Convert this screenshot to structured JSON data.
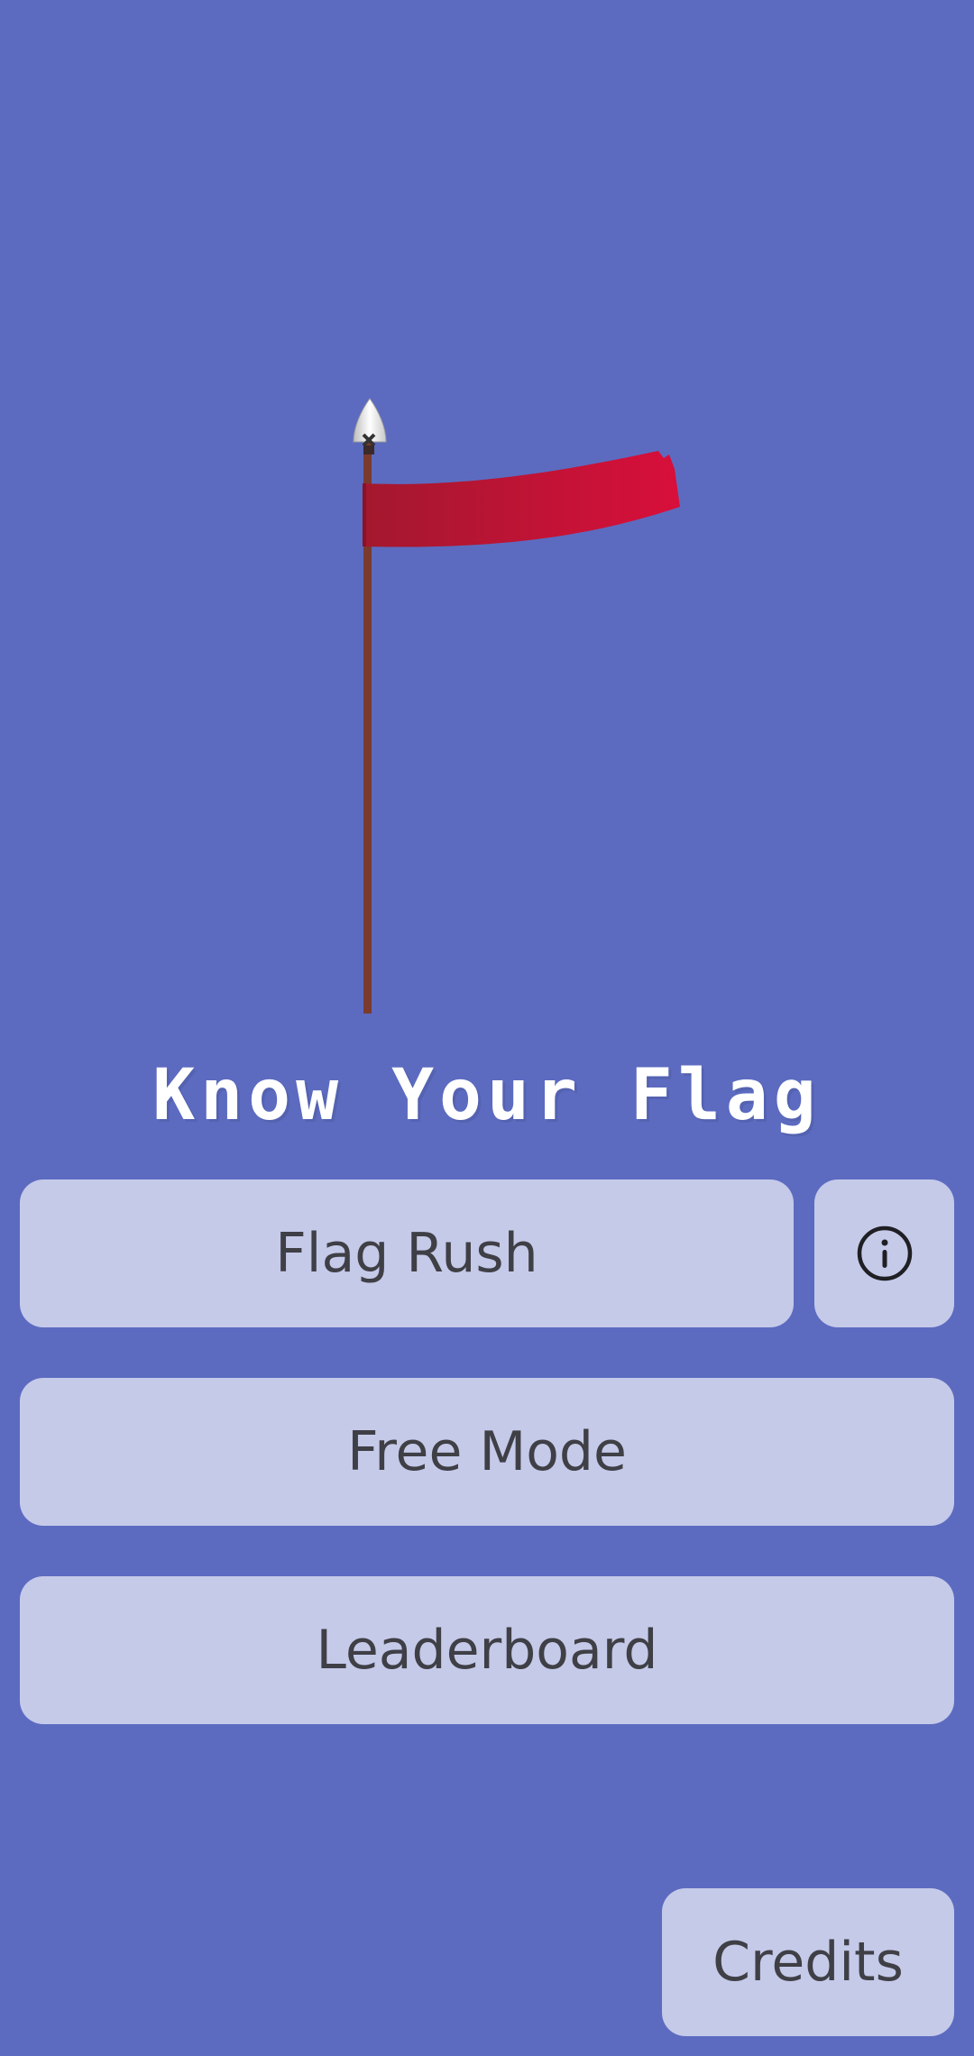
{
  "app": {
    "title": "Know Your Flag"
  },
  "colors": {
    "background": "#5c6bc0",
    "button_background": "#c5cae9",
    "button_text": "#3f3f46",
    "flag_red": "#d0103a",
    "pole_brown": "#7a3b2e"
  },
  "menu": {
    "flag_rush_label": "Flag Rush",
    "info_icon": "info-circle-icon",
    "free_mode_label": "Free Mode",
    "leaderboard_label": "Leaderboard",
    "credits_label": "Credits"
  }
}
